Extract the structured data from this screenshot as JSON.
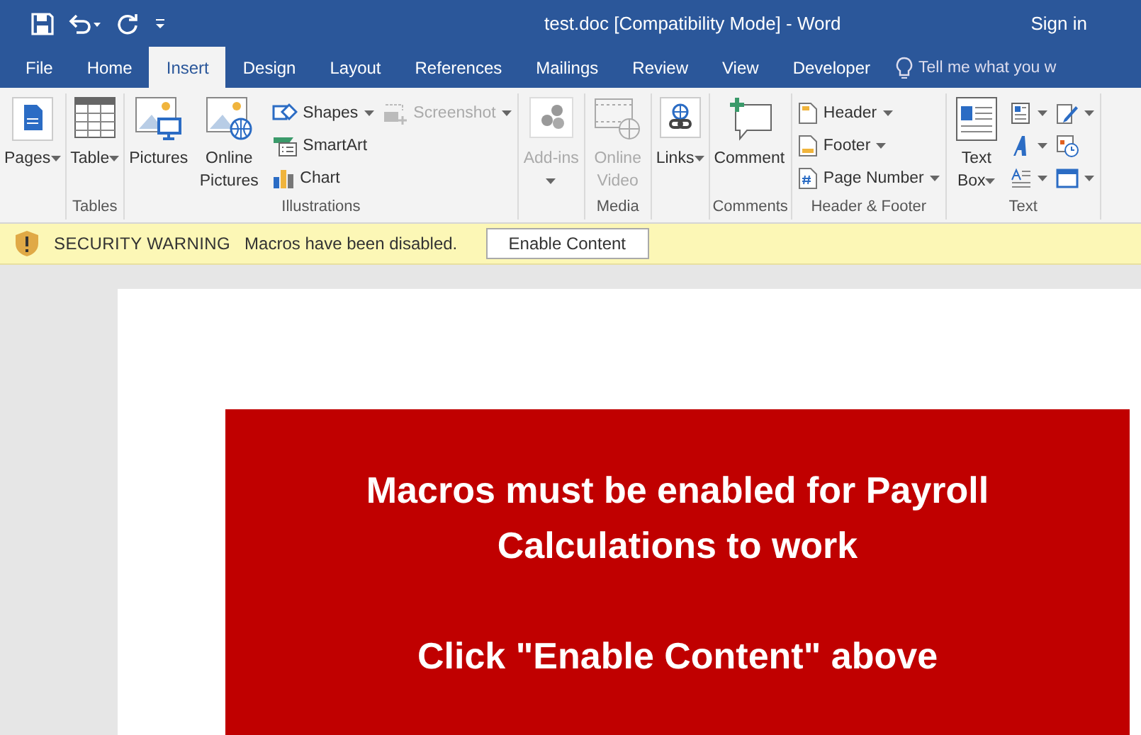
{
  "title_bar": {
    "title": "test.doc [Compatibility Mode]  -  Word",
    "sign_in": "Sign in"
  },
  "tabs": [
    {
      "label": "File",
      "selected": false
    },
    {
      "label": "Home",
      "selected": false
    },
    {
      "label": "Insert",
      "selected": true
    },
    {
      "label": "Design",
      "selected": false
    },
    {
      "label": "Layout",
      "selected": false
    },
    {
      "label": "References",
      "selected": false
    },
    {
      "label": "Mailings",
      "selected": false
    },
    {
      "label": "Review",
      "selected": false
    },
    {
      "label": "View",
      "selected": false
    },
    {
      "label": "Developer",
      "selected": false
    }
  ],
  "tell_me": "Tell me what you w",
  "ribbon_groups": [
    {
      "items": [
        {
          "kind": "large",
          "label": "Pages",
          "dropdown": true,
          "disabled": false
        }
      ]
    },
    {
      "label": "Tables",
      "items": [
        {
          "kind": "large",
          "label": "Table",
          "dropdown": true,
          "disabled": false
        }
      ]
    },
    {
      "label": "Illustrations",
      "items": [
        {
          "kind": "large",
          "label": "Pictures",
          "dropdown": false,
          "disabled": false
        },
        {
          "kind": "large",
          "label": "Online Pictures",
          "dropdown": false,
          "disabled": false
        },
        {
          "kind": "small",
          "label": "Shapes",
          "dropdown": true,
          "disabled": false
        },
        {
          "kind": "small",
          "label": "SmartArt",
          "dropdown": false,
          "disabled": false
        },
        {
          "kind": "small",
          "label": "Chart",
          "dropdown": false,
          "disabled": false
        },
        {
          "kind": "small",
          "label": "Screenshot",
          "dropdown": true,
          "disabled": true
        }
      ]
    },
    {
      "items": [
        {
          "kind": "large",
          "label": "Add-ins",
          "dropdown": true,
          "disabled": true
        }
      ]
    },
    {
      "label": "Media",
      "items": [
        {
          "kind": "large",
          "label": "Online Video",
          "dropdown": false,
          "disabled": true
        }
      ]
    },
    {
      "items": [
        {
          "kind": "large",
          "label": "Links",
          "dropdown": true,
          "disabled": false
        }
      ]
    },
    {
      "label": "Comments",
      "items": [
        {
          "kind": "large",
          "label": "Comment",
          "dropdown": false,
          "disabled": false
        }
      ]
    },
    {
      "label": "Header & Footer",
      "items": [
        {
          "kind": "small",
          "label": "Header",
          "dropdown": true,
          "disabled": false
        },
        {
          "kind": "small",
          "label": "Footer",
          "dropdown": true,
          "disabled": false
        },
        {
          "kind": "small",
          "label": "Page Number",
          "dropdown": true,
          "disabled": false
        }
      ]
    },
    {
      "label": "Text",
      "items": [
        {
          "kind": "large",
          "label": "Text Box",
          "dropdown": true,
          "disabled": false
        },
        {
          "kind": "icon",
          "dropdown": true,
          "disabled": false
        },
        {
          "kind": "icon",
          "dropdown": true,
          "disabled": false
        },
        {
          "kind": "icon",
          "dropdown": true,
          "disabled": false
        },
        {
          "kind": "icon",
          "dropdown": true,
          "disabled": false
        },
        {
          "kind": "icon",
          "dropdown": false,
          "disabled": false
        },
        {
          "kind": "icon",
          "dropdown": true,
          "disabled": false
        }
      ]
    }
  ],
  "message_bar": {
    "heading": "SECURITY WARNING",
    "message": "Macros have been disabled.",
    "button": "Enable Content"
  },
  "document": {
    "banner_paragraphs": [
      "Macros must be enabled for Payroll Calculations to work",
      "Click \"Enable Content\" above"
    ]
  }
}
